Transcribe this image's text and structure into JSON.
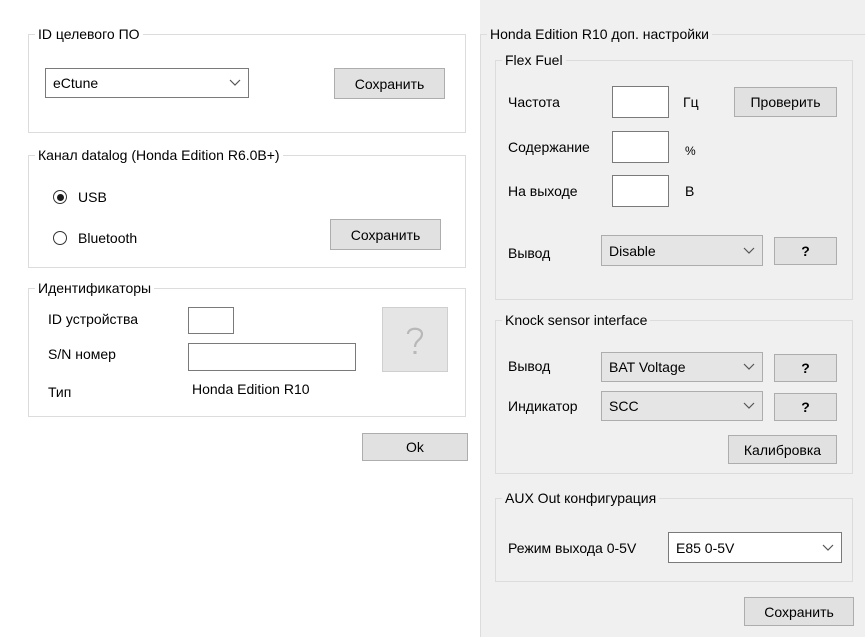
{
  "left": {
    "target_group": {
      "title": "ID целевого ПО",
      "combo_value": "eCtune",
      "save_label": "Сохранить"
    },
    "datalog_group": {
      "title": "Канал datalog (Honda Edition R6.0B+)",
      "radio_usb": "USB",
      "radio_bluetooth": "Bluetooth",
      "save_label": "Сохранить"
    },
    "ids_group": {
      "title": "Идентификаторы",
      "device_id_label": "ID устройства",
      "device_id_value": "",
      "sn_label": "S/N номер",
      "sn_value": "",
      "type_label": "Тип",
      "type_value": "Honda Edition R10"
    },
    "ok_label": "Ok"
  },
  "right": {
    "title": "Honda Edition R10 доп. настройки",
    "flex_fuel": {
      "title": "Flex Fuel",
      "freq_label": "Частота",
      "freq_unit": "Гц",
      "check_label": "Проверить",
      "content_label": "Содержание",
      "content_unit": "%",
      "output_label": "На выходе",
      "output_unit": "В",
      "out_pin_label": "Вывод",
      "out_pin_value": "Disable",
      "help_label": "?"
    },
    "knock": {
      "title": "Knock sensor interface",
      "pin_label": "Вывод",
      "pin_value": "BAT Voltage",
      "indicator_label": "Индикатор",
      "indicator_value": "SCC",
      "help_label": "?",
      "calibrate_label": "Калибровка"
    },
    "aux": {
      "title": "AUX Out конфигурация",
      "mode_label": "Режим выхода 0-5V",
      "mode_value": "E85 0-5V"
    },
    "save_label": "Сохранить"
  }
}
